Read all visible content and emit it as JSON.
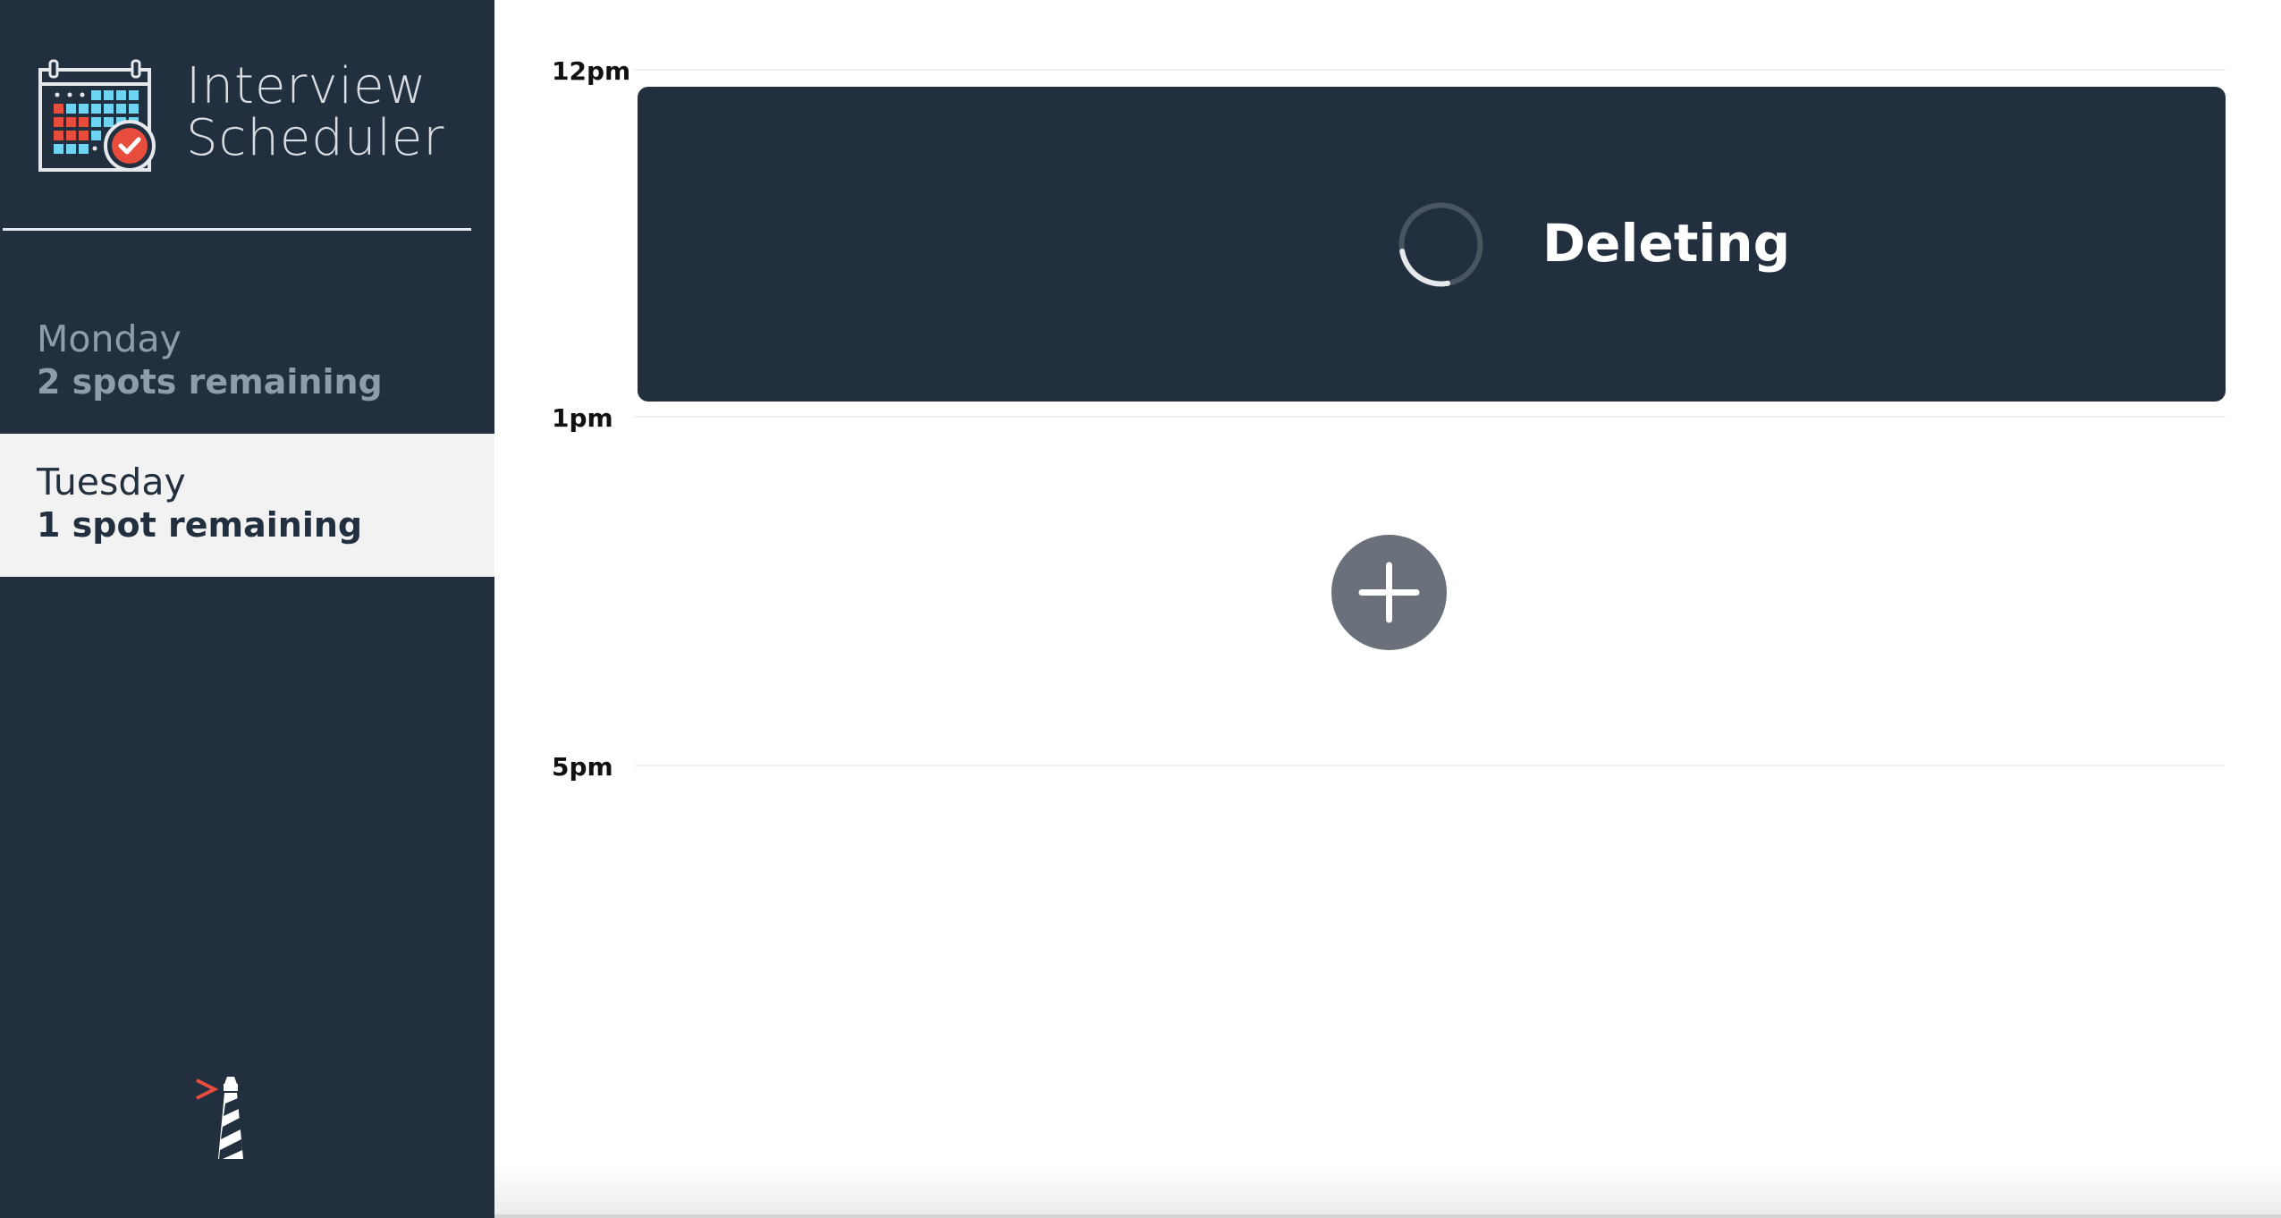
{
  "app": {
    "title_line1": "Interview",
    "title_line2": "Scheduler"
  },
  "sidebar": {
    "days": [
      {
        "name": "Monday",
        "spots": "2 spots remaining",
        "selected": false
      },
      {
        "name": "Tuesday",
        "spots": "1 spot remaining",
        "selected": true
      }
    ]
  },
  "schedule": {
    "times": [
      "12pm",
      "1pm",
      "5pm"
    ],
    "status": {
      "message": "Deleting"
    }
  },
  "icons": {
    "logo": "calendar-check-icon",
    "spinner": "loading-spinner-icon",
    "add": "plus-icon",
    "footer": "lighthouse-icon"
  },
  "colors": {
    "sidebar_bg": "#222f3e",
    "selected_day_bg": "#f2f2f2",
    "accent_red": "#e74c3c",
    "calendar_blue": "#6fd3f2",
    "add_button": "#6a717a"
  }
}
